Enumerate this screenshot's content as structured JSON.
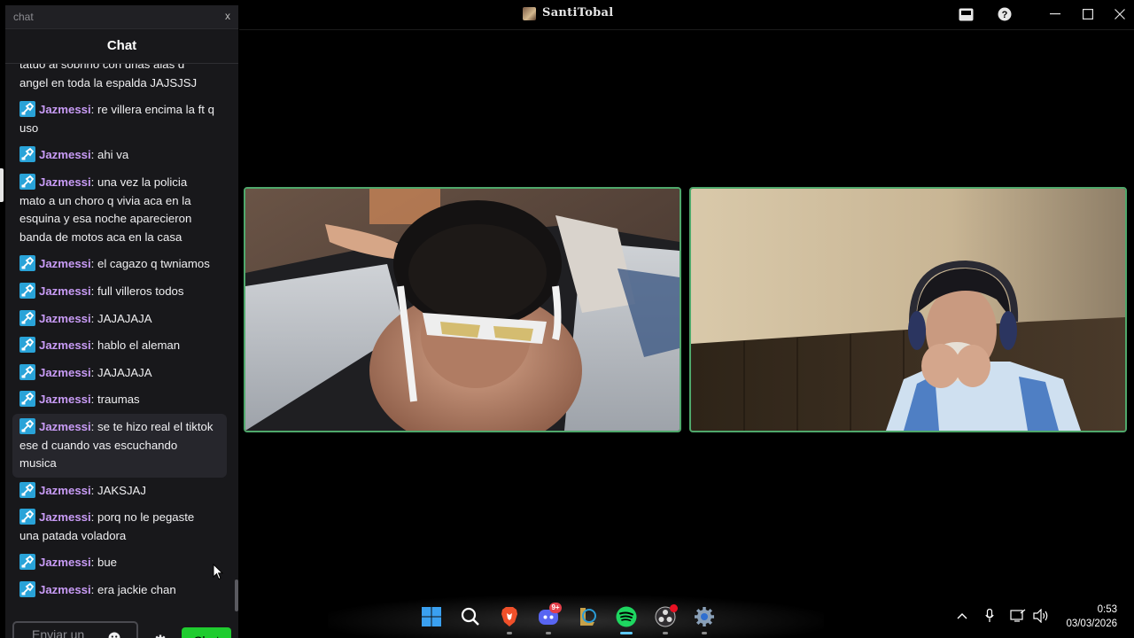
{
  "window": {
    "title": "SantiTobal"
  },
  "chat": {
    "search_placeholder": "chat",
    "search_close": "x",
    "header": "Chat",
    "messages": [
      {
        "user": "",
        "text": "tatuo al sobrino con unas alas d angel en toda la espalda JAJSJSJ",
        "badge": false,
        "highlight": false
      },
      {
        "user": "Jazmessi",
        "text": "re villera encima la ft q uso",
        "badge": true,
        "highlight": false
      },
      {
        "user": "Jazmessi",
        "text": "ahi va",
        "badge": true,
        "highlight": false
      },
      {
        "user": "Jazmessi",
        "text": "una vez la policia mato a un choro q vivia aca en la esquina y esa noche aparecieron banda de motos aca en la casa",
        "badge": true,
        "highlight": false
      },
      {
        "user": "Jazmessi",
        "text": "el cagazo q twniamos",
        "badge": true,
        "highlight": false
      },
      {
        "user": "Jazmessi",
        "text": "full villeros todos",
        "badge": true,
        "highlight": false
      },
      {
        "user": "Jazmessi",
        "text": "JAJAJAJA",
        "badge": true,
        "highlight": false
      },
      {
        "user": "Jazmessi",
        "text": "hablo el aleman",
        "badge": true,
        "highlight": false
      },
      {
        "user": "Jazmessi",
        "text": "JAJAJAJA",
        "badge": true,
        "highlight": false
      },
      {
        "user": "Jazmessi",
        "text": "traumas",
        "badge": true,
        "highlight": false
      },
      {
        "user": "Jazmessi",
        "text": "se te hizo real el tiktok ese d cuando vas escuchando musica",
        "badge": true,
        "highlight": true
      },
      {
        "user": "Jazmessi",
        "text": "JAKSJAJ",
        "badge": true,
        "highlight": false
      },
      {
        "user": "Jazmessi",
        "text": "porq no le pegaste una patada voladora",
        "badge": true,
        "highlight": false
      },
      {
        "user": "Jazmessi",
        "text": "bue",
        "badge": true,
        "highlight": false
      },
      {
        "user": "Jazmessi",
        "text": "era jackie chan",
        "badge": true,
        "highlight": false
      }
    ],
    "input_placeholder": "Enviar un",
    "send_label": "Chat"
  },
  "taskbar": {
    "apps": [
      "start-icon",
      "search-icon",
      "brave-icon",
      "discord-icon",
      "league-icon",
      "spotify-icon",
      "obs-icon",
      "settings-icon"
    ],
    "discord_badge": "9+",
    "time": "0:53",
    "date": "03/03/2026"
  },
  "colors": {
    "username": "#c89bf5",
    "badge": "#29a3d8",
    "send_button": "#1fcc2f",
    "tile_border": "#4fa86b"
  }
}
